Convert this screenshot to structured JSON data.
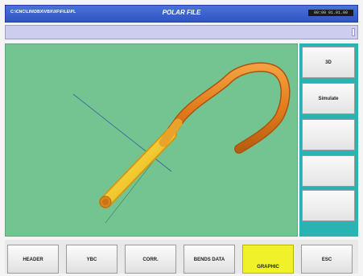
{
  "window": {
    "path": "C:\\CNC\\LIN\\DBX\\VBX\\XF\\FILE\\PL",
    "title": "POLAR FILE",
    "clock": "00:00 01.01.00"
  },
  "side_buttons": [
    "3D",
    "Simulate",
    "",
    "",
    ""
  ],
  "bottom_buttons": [
    "HEADER",
    "YBC",
    "CORR.",
    "BENDS DATA",
    "GRAPHIC",
    "ESC"
  ],
  "active_bottom": "GRAPHIC",
  "colors": {
    "titlebar": "#3a60cc",
    "viewport": "#74c492",
    "side_panel": "#2ab3b3",
    "tube_orange": "#e88a1e",
    "tube_yellow": "#f2d533",
    "active_button": "#f1f12a"
  }
}
